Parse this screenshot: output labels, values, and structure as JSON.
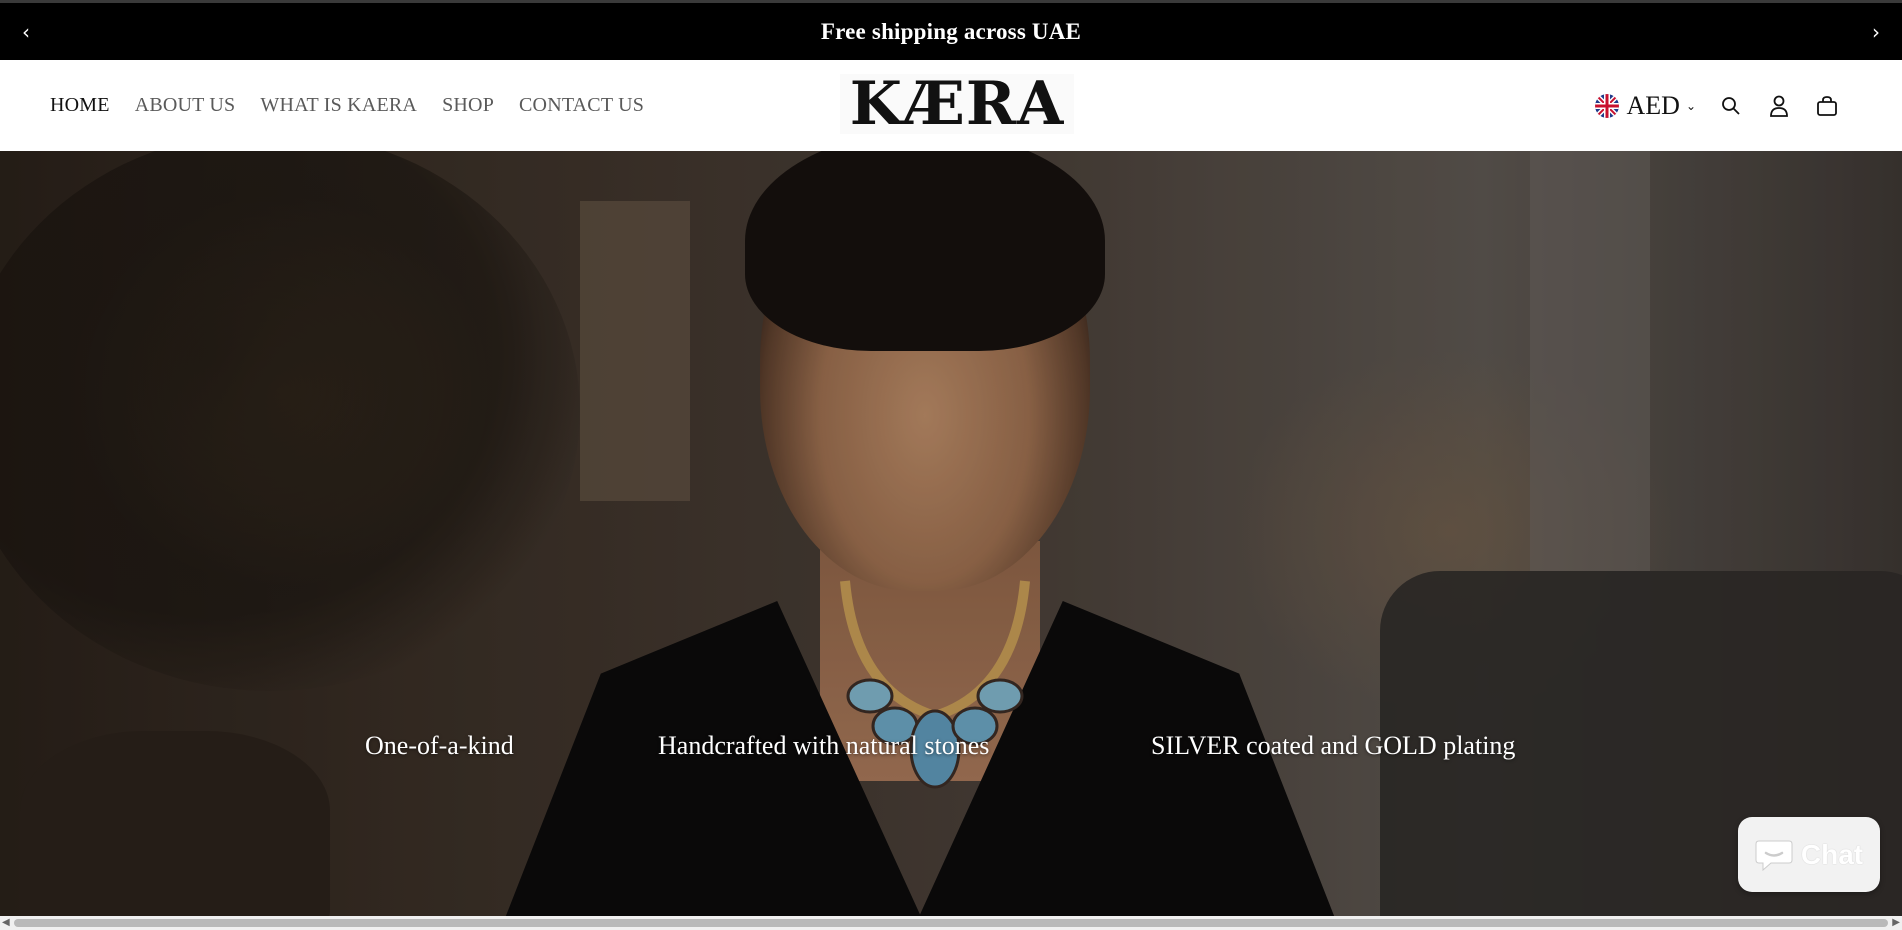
{
  "announcement": {
    "text": "Free shipping across UAE",
    "prev_icon": "chevron-left-icon",
    "next_icon": "chevron-right-icon"
  },
  "header": {
    "nav": [
      {
        "label": "HOME",
        "active": true
      },
      {
        "label": "ABOUT US",
        "active": false
      },
      {
        "label": "WHAT IS KAERA",
        "active": false
      },
      {
        "label": "SHOP",
        "active": false
      },
      {
        "label": "CONTACT US",
        "active": false
      }
    ],
    "logo": "KÆRA",
    "currency": {
      "code": "AED",
      "flag_icon": "uk-flag-icon"
    },
    "icons": [
      "search-icon",
      "account-icon",
      "cart-icon"
    ]
  },
  "hero": {
    "features": [
      "One-of-a-kind",
      "Handcrafted with natural stones",
      "SILVER coated and GOLD plating"
    ]
  },
  "chat": {
    "label": "Chat",
    "icon": "chat-bubble-icon",
    "color": "#f2f2f2"
  },
  "colors": {
    "announcement_bg": "#000000",
    "header_bg": "#ffffff",
    "text_active": "#111111",
    "text_nav": "#5a5a5a"
  }
}
